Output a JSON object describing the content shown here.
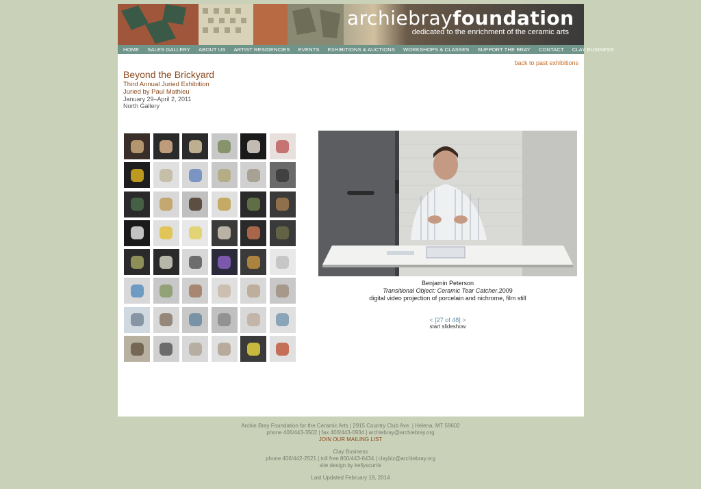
{
  "brand": {
    "name_light": "archiebray",
    "name_bold": "foundation",
    "tagline": "dedicated to the enrichment of the ceramic arts"
  },
  "nav": [
    "HOME",
    "SALES GALLERY",
    "ABOUT US",
    "ARTIST RESIDENCIES",
    "EVENTS",
    "EXHIBITIONS & AUCTIONS",
    "WORKSHOPS & CLASSES",
    "SUPPORT THE BRAY",
    "CONTACT",
    "CLAY BUSINESS"
  ],
  "back_link": "back to past exhibitions",
  "exhibition": {
    "title": "Beyond the Brickyard",
    "subtitle": "Third Annual Juried Exhibition",
    "juror": "Juried by Paul Mathieu",
    "dates": "January 29–April 2, 2011",
    "gallery": "North Gallery"
  },
  "thumbnail_count": 48,
  "current": {
    "artist": "Benjamin Peterson",
    "title": "Transitional Object: Ceramic Tear Catcher",
    "year": ",2009",
    "medium": "digital video projection of porcelain and nichrome, film still"
  },
  "pager": {
    "prev": "<",
    "position": "[27 of 48]",
    "next": ">"
  },
  "slideshow": "start slideshow",
  "footer": {
    "line1": "Archie Bray Foundation for the Ceramic Arts | 2915 Country Club Ave. | Helena, MT 59602",
    "line2": "phone 406/443-3502 | fax 406/443-0934 | archiebray@archiebray.org",
    "mailing": "JOIN OUR MAILING LIST",
    "clay_title": "Clay Business",
    "clay_line": "phone 406/442-2521 | toll free 800/443-6434 | claybiz@archiebray.org",
    "design": "site design by kellyscurtis",
    "updated": "Last Updated February 19, 2014"
  }
}
